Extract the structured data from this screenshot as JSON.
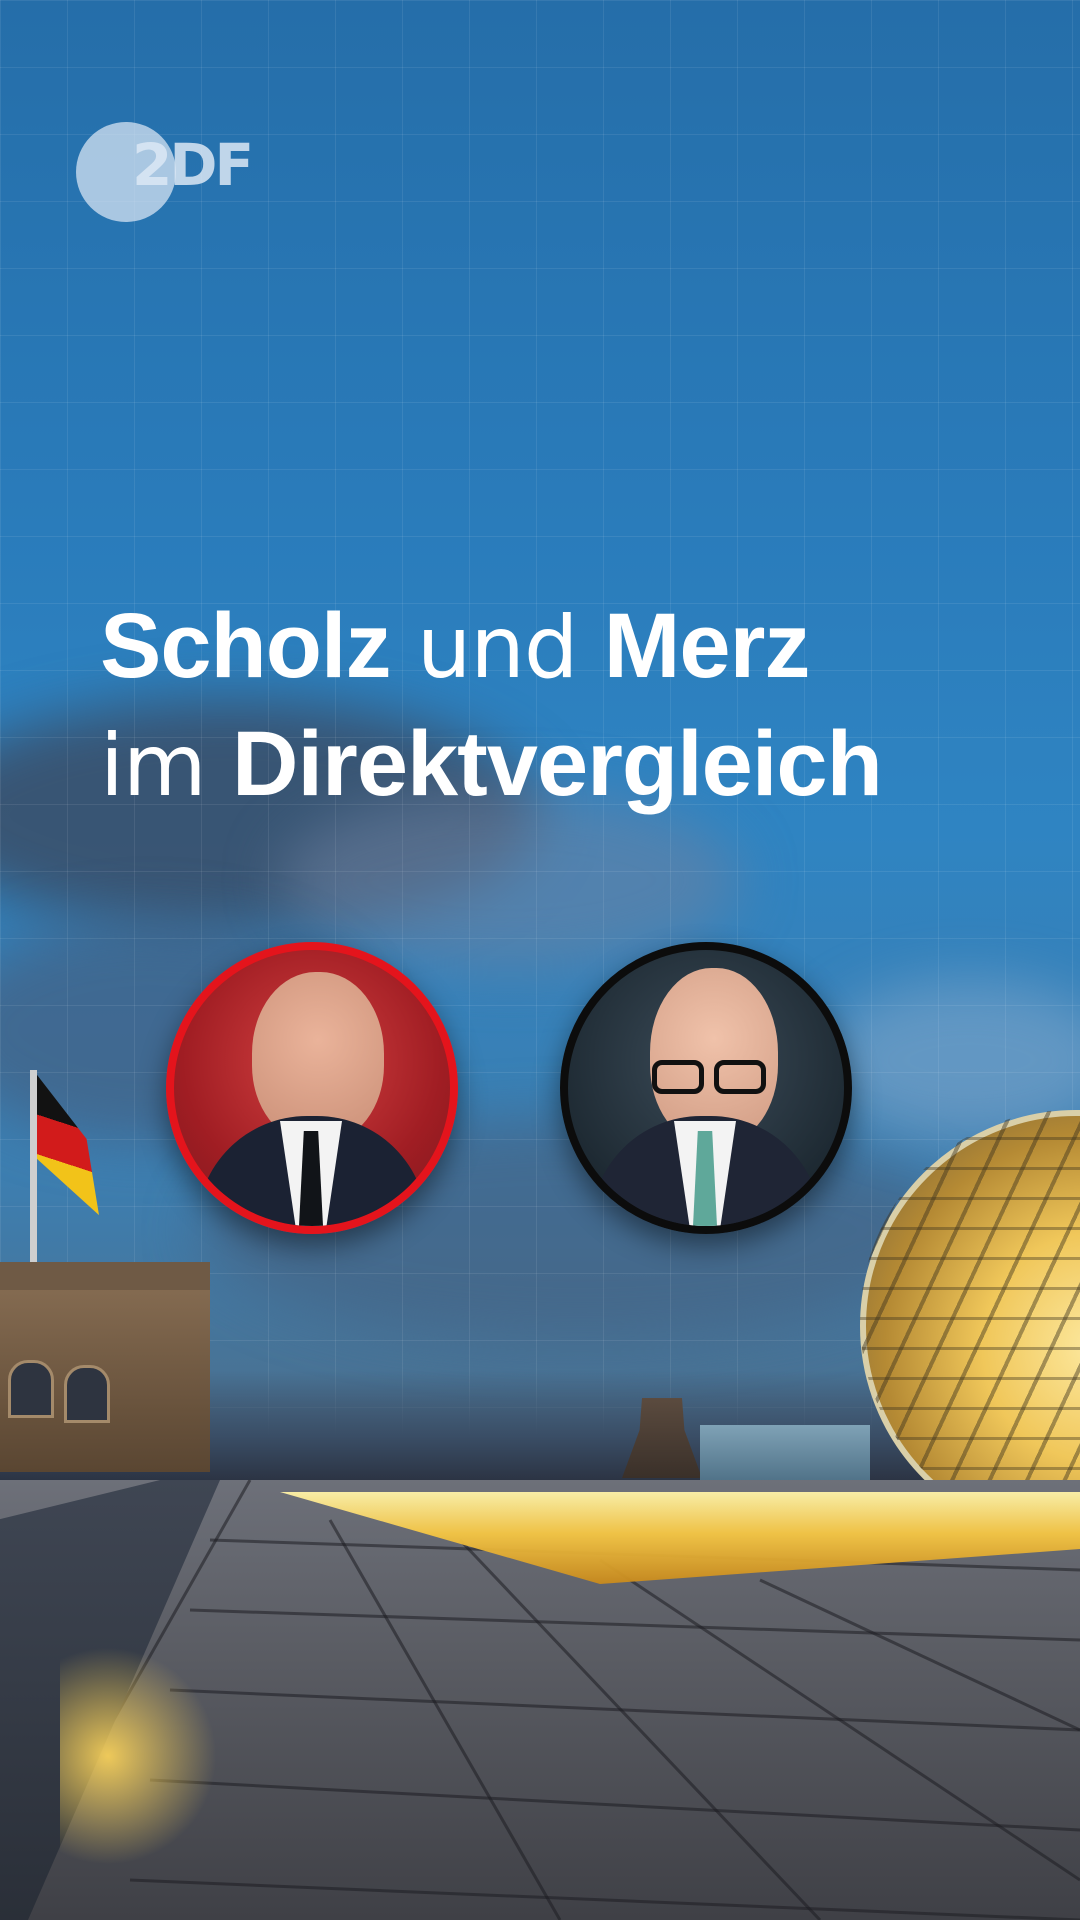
{
  "logo": {
    "text": "2DF"
  },
  "headline": {
    "line1": {
      "part1": "Scholz",
      "part2": " und ",
      "part3": "Merz"
    },
    "line2": {
      "part1": "im ",
      "part2": "Direktvergleich"
    }
  },
  "portraits": [
    {
      "name": "scholz-portrait",
      "ring_color": "#e4141c"
    },
    {
      "name": "merz-portrait",
      "ring_color": "#0c0c0c"
    }
  ],
  "colors": {
    "sky": "#2a7cbb",
    "text": "#ffffff",
    "accent_red": "#e4141c"
  }
}
